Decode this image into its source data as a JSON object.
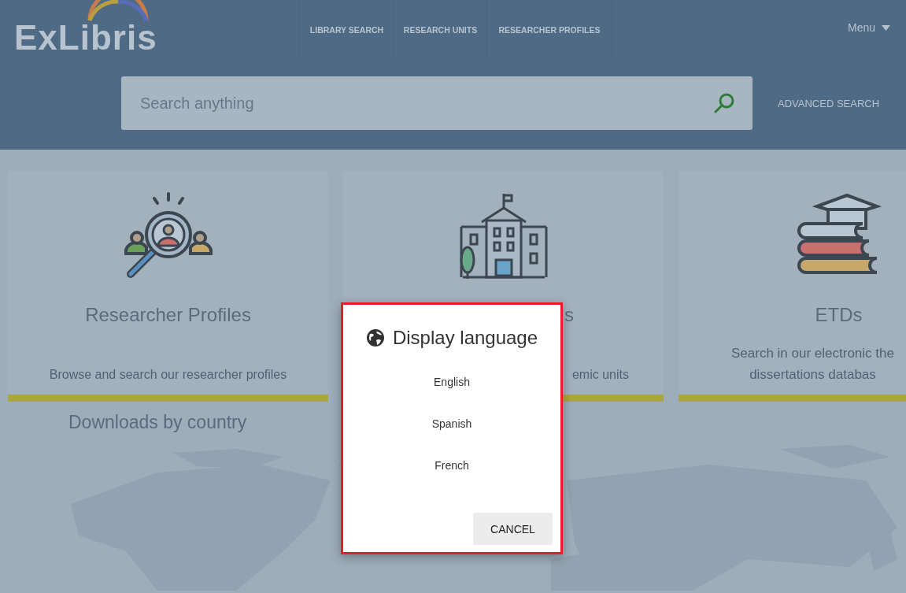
{
  "header": {
    "logo": "ExLibris",
    "nav": [
      "LIBRARY SEARCH",
      "RESEARCH UNITS",
      "RESEARCHER PROFILES"
    ],
    "menu": "Menu"
  },
  "search": {
    "placeholder": "Search anything",
    "advanced": "ADVANCED SEARCH"
  },
  "cards": [
    {
      "kind": "profiles",
      "title": "Researcher Profiles",
      "description": "Browse and search our researcher profiles"
    },
    {
      "kind": "units",
      "title": "s",
      "description": "emic units"
    },
    {
      "kind": "etds",
      "title": "ETDs",
      "description": "Search in our electronic the\ndissertations databas"
    }
  ],
  "downloads": {
    "title": "Downloads by country",
    "kind": "picture"
  },
  "dialog": {
    "title": "Display language",
    "options": [
      "English",
      "Spanish",
      "French"
    ],
    "cancel": "CANCEL"
  }
}
